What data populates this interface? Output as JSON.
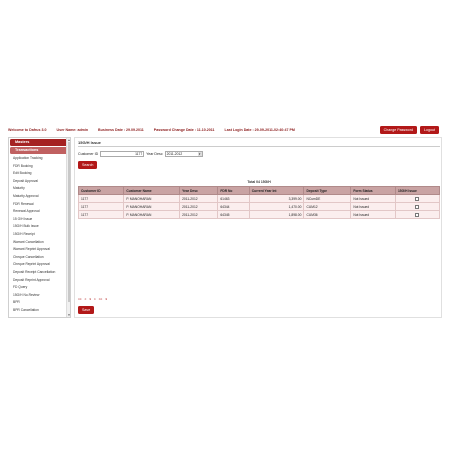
{
  "header": {
    "welcome": "Welcome to Dafrus 3.0",
    "user": "User Name: admin",
    "business_date": "Business Date : 29.09.2011",
    "password_change": "Password Change Date : 11.10.2011",
    "last_login": "Last Login Date : 29-09-2011-02:40:47 PM",
    "change_password_label": "Change Password",
    "logout_label": "Logout"
  },
  "sidebar": {
    "masters_label": "Masters",
    "transactions_label": "Transactions",
    "items": [
      "Application Tracking",
      "FDR Booking",
      "Edit Booking",
      "Deposit Approval",
      "Maturity",
      "Maturity Approval",
      "FDR Renewal",
      "Renewal Approval",
      "15 G/H Issue",
      "15G/H Bulk Issue",
      "15G/H Receipt",
      "Warrant Cancellation",
      "Warrant Reprint Approval",
      "Cheque Cancellation",
      "Cheque Reprint Approval",
      "Deposit Receipt Cancellation",
      "Deposit Reprint Approval",
      "FD Query",
      "15G/H No.Review",
      "BPR",
      "BPR Cancellation"
    ]
  },
  "main": {
    "title": "15G/H Issue",
    "customer_id_label": "Customer ID",
    "customer_id_value": "1177",
    "year_desc_label": "Year Desc",
    "year_desc_value": "2011-2012",
    "search_label": "Search",
    "table_caption": "Total 04 15G/H",
    "columns": [
      "Customer ID",
      "Customer Name",
      "Year Desc",
      "FDR No",
      "Current Year Int",
      "Deposit Type",
      "Form Status",
      "15G/H Issue"
    ],
    "rows": [
      [
        "1177",
        "P. MANOHARAN",
        "2011-2012",
        "61463",
        "3,399.00",
        "NCumDE",
        "Not Issued"
      ],
      [
        "1177",
        "P. MANOHARAN",
        "2011-2012",
        "64344",
        "1,470.00",
        "CUM12",
        "Not Issued"
      ],
      [
        "1177",
        "P. MANOHARAN",
        "2011-2012",
        "64345",
        "1,898.00",
        "CUM36",
        "Not Issued"
      ]
    ],
    "pager": [
      "<<",
      "<",
      "1",
      ">",
      ">>",
      "1"
    ],
    "save_label": "Save"
  },
  "colors": {
    "accent": "#b21818",
    "header_text": "#8b1a1a",
    "table_header": "#c9a3a3",
    "row_bg": "#fbeeee"
  }
}
